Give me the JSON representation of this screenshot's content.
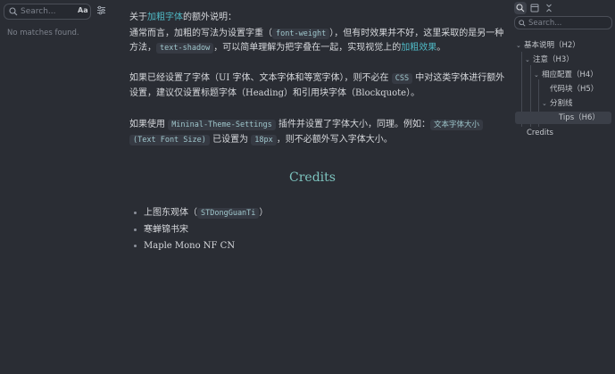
{
  "search": {
    "placeholder": "Search...",
    "case_toggle": "Aa",
    "empty_text": "No matches found."
  },
  "outline_pane": {
    "search_placeholder": "Search...",
    "items": [
      {
        "label": "基本说明（H2）"
      },
      {
        "label": "注意（H3）"
      },
      {
        "label": "相应配置（H4）"
      },
      {
        "label": "代码块（H5）"
      },
      {
        "label": "分割线"
      },
      {
        "label": "Tips（H6）"
      },
      {
        "label": "Credits"
      }
    ]
  },
  "content": {
    "para1": {
      "l1_a": "关于",
      "l1_hl": "加粗字体",
      "l1_b": "的额外说明：",
      "l2_a": "通常而言，加粗的写法为设置字重（",
      "l2_code": "font-weight",
      "l2_b": "），但有时效果并不好，这里采取的是另一种",
      "l3_a": "方法，",
      "l3_code": "text-shadow",
      "l3_b": "，可以简单理解为把字叠在一起，实现视觉上的",
      "l3_hl": "加粗效果",
      "l3_c": "。"
    },
    "para2": {
      "l1_a": "如果已经设置了字体（UI 字体、文本字体和等宽字体），则不必在",
      "l1_code": "CSS",
      "l1_b": "中对这类字体进行额外",
      "l2": "设置，建议仅设置标题字体（Heading）和引用块字体（Blockquote）。"
    },
    "para3": {
      "l1_a": "如果使用",
      "l1_code": "Mininal-Theme-Settings",
      "l1_b": "插件并设置了字体大小，同理。例如：",
      "l1_code2": "文本字体大小",
      "l2_code": "(Text Font Size)",
      "l2_a": "已设置为",
      "l2_code2": "18px",
      "l2_b": "，则不必额外写入字体大小。"
    },
    "heading": "Credits",
    "credits": {
      "item1_text": "上图东观体（",
      "item1_code": "STDongGuanTi",
      "item1_close": "）",
      "item2": "寒蝉锦书宋",
      "item3": "Maple Mono NF CN"
    }
  }
}
